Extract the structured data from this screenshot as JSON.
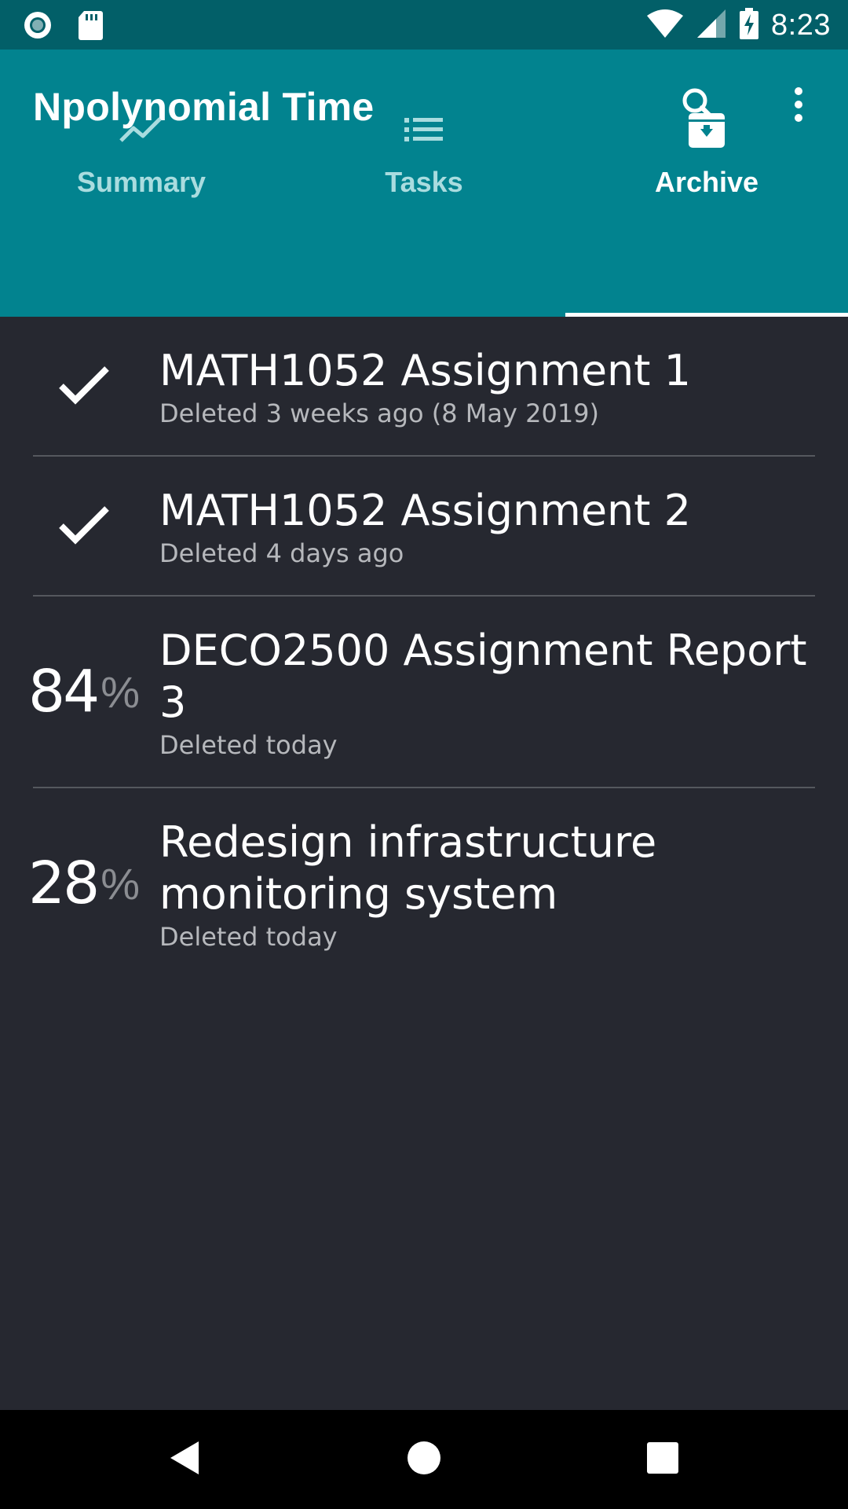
{
  "status_bar": {
    "time": "8:23",
    "left_icons": [
      "record-icon",
      "sd-card-icon"
    ],
    "right_icons": [
      "wifi-icon",
      "signal-icon",
      "battery-charging-icon"
    ]
  },
  "app_bar": {
    "title": "Npolynomial Time",
    "actions": [
      "search-icon",
      "more-vert-icon"
    ],
    "color": "#02838f"
  },
  "tabs": [
    {
      "label": "Summary",
      "icon": "trending-up-icon",
      "active": false
    },
    {
      "label": "Tasks",
      "icon": "list-icon",
      "active": false
    },
    {
      "label": "Archive",
      "icon": "archive-icon",
      "active": true
    }
  ],
  "items": [
    {
      "status": "done",
      "title": "MATH1052 Assignment 1",
      "subtitle": "Deleted 3 weeks ago (8 May 2019)"
    },
    {
      "status": "done",
      "title": "MATH1052 Assignment 2",
      "subtitle": "Deleted 4 days ago"
    },
    {
      "status": "progress",
      "percent": "84",
      "percent_symbol": "%",
      "title": "DECO2500 Assignment Report 3",
      "subtitle": "Deleted today"
    },
    {
      "status": "progress",
      "percent": "28",
      "percent_symbol": "%",
      "title": "Redesign infrastructure monitoring system",
      "subtitle": "Deleted today"
    }
  ],
  "nav_bar": [
    "back-icon",
    "home-icon",
    "recents-icon"
  ]
}
